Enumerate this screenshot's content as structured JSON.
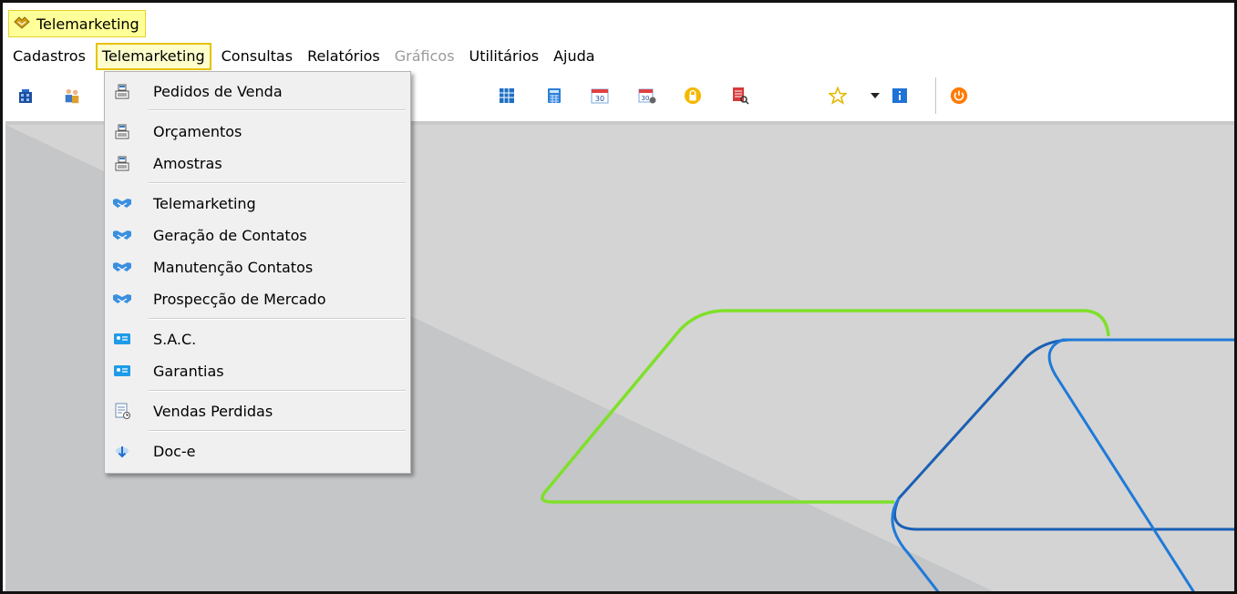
{
  "window": {
    "title": "Telemarketing"
  },
  "menubar": {
    "items": [
      {
        "label": "Cadastros",
        "state": "normal"
      },
      {
        "label": "Telemarketing",
        "state": "active"
      },
      {
        "label": "Consultas",
        "state": "normal"
      },
      {
        "label": "Relatórios",
        "state": "normal"
      },
      {
        "label": "Gráficos",
        "state": "disabled"
      },
      {
        "label": "Utilitários",
        "state": "normal"
      },
      {
        "label": "Ajuda",
        "state": "normal"
      }
    ]
  },
  "toolbar": {
    "icons": [
      "building-icon",
      "people-icon",
      "grid-calculator-icon",
      "calculator-icon",
      "calendar-30-icon",
      "calendar-gear-icon",
      "lock-icon",
      "report-search-icon",
      "star-icon",
      "dropdown-arrow-icon",
      "info-icon",
      "power-icon"
    ]
  },
  "dropdown": {
    "items": [
      {
        "label": "Pedidos de Venda",
        "icon": "cash-register-icon"
      },
      {
        "label": "Orçamentos",
        "icon": "cash-register-icon"
      },
      {
        "label": "Amostras",
        "icon": "cash-register-icon"
      },
      {
        "label": "Telemarketing",
        "icon": "handshake-icon"
      },
      {
        "label": "Geração de Contatos",
        "icon": "handshake-icon"
      },
      {
        "label": "Manutenção Contatos",
        "icon": "handshake-icon"
      },
      {
        "label": "Prospecção de Mercado",
        "icon": "handshake-icon"
      },
      {
        "label": "S.A.C.",
        "icon": "id-card-icon"
      },
      {
        "label": "Garantias",
        "icon": "id-card-icon"
      },
      {
        "label": "Vendas Perdidas",
        "icon": "document-clock-icon"
      },
      {
        "label": "Doc-e",
        "icon": "cloud-download-icon"
      }
    ]
  },
  "colors": {
    "title_bg": "#ffff99",
    "menu_active_border": "#e6c200",
    "workspace_bg": "#d4d4d4",
    "logo_green": "#7ae22a",
    "logo_blue": "#1a5fb4"
  }
}
